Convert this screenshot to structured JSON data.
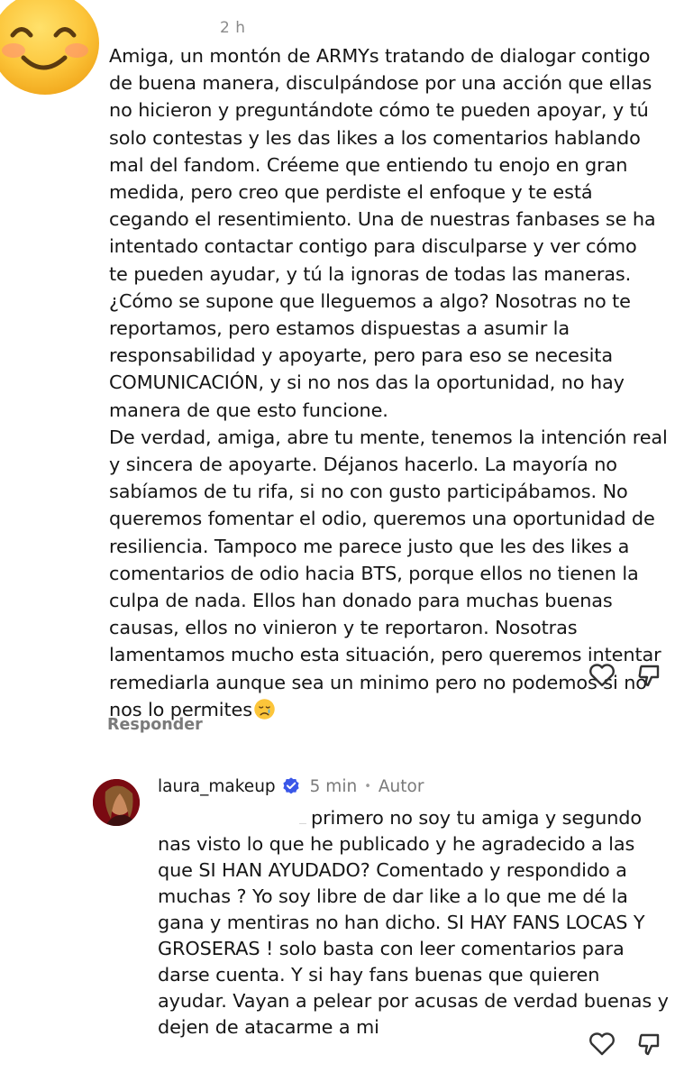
{
  "comment1": {
    "time": "2 h",
    "lines": [
      "Amiga, un montón de ARMYs tratando de dialogar contigo",
      "de buena manera, disculpándose por una acción que ellas",
      "no hicieron y preguntándote cómo te pueden apoyar, y tú",
      "solo contestas y les das likes a los comentarios hablando",
      "mal del fandom. Créeme que entiendo tu enojo en gran",
      "medida, pero creo que perdiste el enfoque y te está",
      "cegando el resentimiento. Una de nuestras fanbases se ha",
      "intentado contactar contigo para disculparse y ver cómo",
      "te pueden ayudar, y tú la ignoras de todas las maneras.",
      "¿Cómo se supone que lleguemos a algo? Nosotras no te",
      "reportamos, pero estamos dispuestas a asumir la",
      "responsabilidad y apoyarte, pero para eso se necesita",
      "COMUNICACIÓN, y si no nos das la oportunidad, no hay",
      "manera de que esto funcione.",
      "De verdad, amiga, abre tu mente, tenemos la intención real",
      "y sincera de apoyarte. Déjanos hacerlo. La mayoría no",
      "sabíamos de tu rifa, si no con gusto participábamos. No",
      "queremos fomentar el odio, queremos una oportunidad de",
      "resiliencia. Tampoco me parece justo que les des likes a",
      "comentarios de odio hacia BTS, porque ellos no tienen la",
      "culpa de nada. Ellos han donado para muchas buenas",
      "causas, ellos no vinieron y te reportaron. Nosotras",
      "lamentamos mucho esta situación, pero queremos intentar",
      "remediarla aunque sea un minimo pero no podemos si no",
      "nos lo permites"
    ],
    "avatar_icon": "smiling-face-with-smiling-eyes-emoji",
    "trailing_emoji": "crying-face-emoji",
    "reply_label": "Responder"
  },
  "comment2": {
    "username": "laura_makeup",
    "verified_icon": "verified-badge-icon",
    "time": "5 min",
    "separator": "•",
    "badge": "Autor",
    "lines": [
      "primero no soy tu amiga y segundo",
      "nas visto lo que he publicado y he agradecido a las",
      "que SI HAN AYUDADO? Comentado y respondido a",
      "muchas ? Yo soy libre de dar like a lo que me dé la",
      "gana y mentiras no han dicho. SI HAY FANS LOCAS Y",
      "GROSERAS ! solo basta con leer comentarios para",
      "darse cuenta. Y si hay fans buenas que quieren",
      "ayudar. Vayan a pelear por acusas de verdad buenas y",
      "dejen de atacarme a mi"
    ]
  },
  "colors": {
    "text": "#151515",
    "muted": "#7a7a7a",
    "verified": "#3a57e8",
    "background": "#ffffff"
  }
}
